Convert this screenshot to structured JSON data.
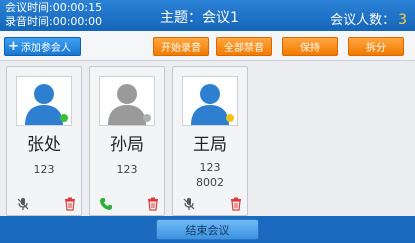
{
  "header": {
    "meeting_time_label": "会议时间:00:00:15",
    "record_time_label": "录音时间:00:00:00",
    "title": "主题：会议1",
    "count_label": "会议人数：",
    "count_value": "3"
  },
  "toolbar": {
    "add_label": "添加参会人",
    "start_record": "开始录音",
    "mute_all": "全部禁音",
    "hold": "保持",
    "split": "拆分"
  },
  "participants": [
    {
      "name": "张处",
      "num1": "123",
      "num2": "",
      "avatar_color": "#2f7fd0",
      "status_color": "#3bbf3b",
      "action_icon": "mic-muted-icon"
    },
    {
      "name": "孙局",
      "num1": "123",
      "num2": "",
      "avatar_color": "#9a9a9a",
      "status_color": "#b0b0b0",
      "action_icon": "phone-icon"
    },
    {
      "name": "王局",
      "num1": "123",
      "num2": "8002",
      "avatar_color": "#2f7fd0",
      "status_color": "#f2c21b",
      "action_icon": "mic-muted-icon"
    }
  ],
  "footer": {
    "end_label": "结束会议"
  }
}
